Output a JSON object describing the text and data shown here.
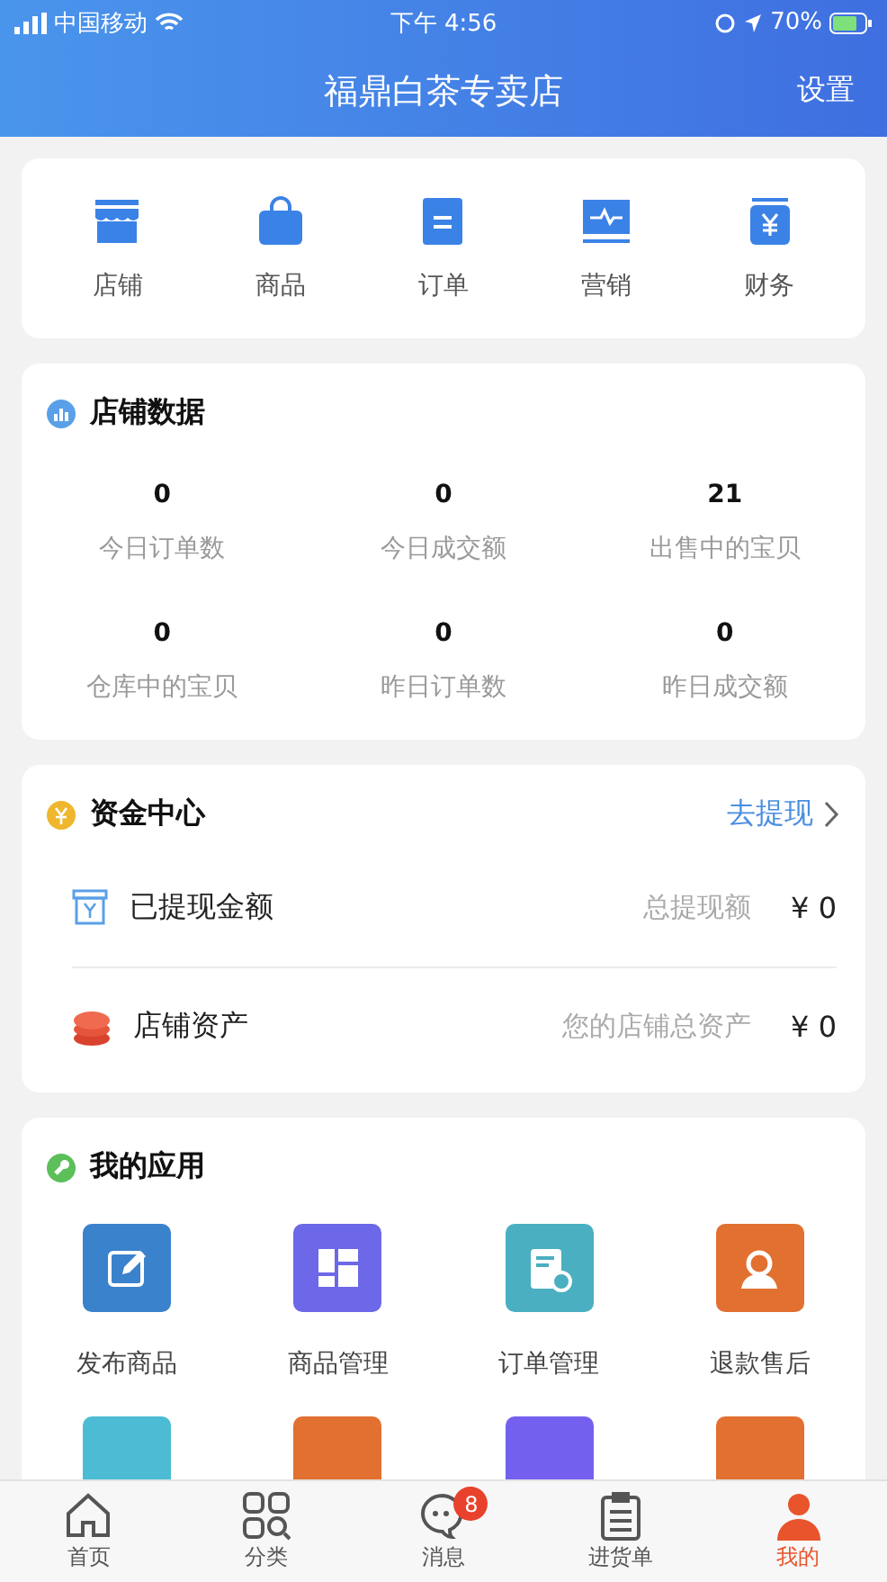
{
  "status_bar": {
    "carrier": "中国移动",
    "time": "下午 4:56",
    "battery": "70%"
  },
  "header": {
    "title": "福鼎白茶专卖店",
    "action": "设置"
  },
  "quick_menu": [
    {
      "label": "店铺",
      "kind": "store"
    },
    {
      "label": "商品",
      "kind": "bag"
    },
    {
      "label": "订单",
      "kind": "order"
    },
    {
      "label": "营销",
      "kind": "pulse"
    },
    {
      "label": "财务",
      "kind": "finance"
    }
  ],
  "shop_data": {
    "title": "店铺数据",
    "stats": [
      {
        "value": "0",
        "label": "今日订单数"
      },
      {
        "value": "0",
        "label": "今日成交额"
      },
      {
        "value": "21",
        "label": "出售中的宝贝"
      },
      {
        "value": "0",
        "label": "仓库中的宝贝"
      },
      {
        "value": "0",
        "label": "昨日订单数"
      },
      {
        "value": "0",
        "label": "昨日成交额"
      }
    ]
  },
  "funds": {
    "title": "资金中心",
    "link": "去提现",
    "rows": [
      {
        "kind": "withdrawn",
        "label": "已提现金额",
        "hint": "总提现额",
        "amount": "¥ 0"
      },
      {
        "kind": "assets",
        "label": "店铺资产",
        "hint": "您的店铺总资产",
        "amount": "¥ 0"
      }
    ]
  },
  "apps": {
    "title": "我的应用",
    "items": [
      {
        "label": "发布商品",
        "kind": "edit",
        "color": "#3a82cc"
      },
      {
        "label": "商品管理",
        "kind": "layout",
        "color": "#6c68e8"
      },
      {
        "label": "订单管理",
        "kind": "doc",
        "color": "#4aafc0"
      },
      {
        "label": "退款售后",
        "kind": "support",
        "color": "#e27030"
      },
      {
        "kind": "blank",
        "color": "#4cbcd4"
      },
      {
        "kind": "blank",
        "color": "#e27030"
      },
      {
        "kind": "blank",
        "color": "#7460ee"
      },
      {
        "kind": "blank",
        "color": "#e27030"
      }
    ]
  },
  "tab_bar": [
    {
      "label": "首页",
      "kind": "home",
      "selected": false
    },
    {
      "label": "分类",
      "kind": "grid",
      "selected": false
    },
    {
      "label": "消息",
      "kind": "chat",
      "selected": false,
      "badge": "8"
    },
    {
      "label": "进货单",
      "kind": "clipboard",
      "selected": false
    },
    {
      "label": "我的",
      "kind": "person",
      "selected": true
    }
  ]
}
